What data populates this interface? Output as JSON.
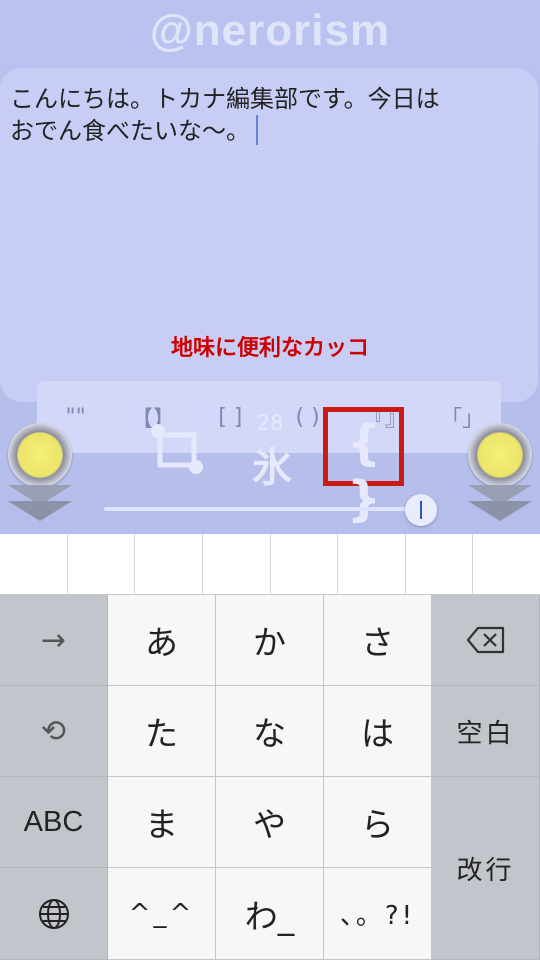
{
  "watermark": "@nerorism",
  "editor": {
    "line1": "こんにちは。トカナ編集部です。今日は",
    "line2": "おでん食べたいな〜。"
  },
  "caption": "地味に便利なカッコ",
  "bracket_palette": [
    "\"\"",
    "【】",
    "[ ]",
    "( )",
    "『』",
    "「」"
  ],
  "toolbar": {
    "font_size_count": "28",
    "font_size_glyph": "氷",
    "braces_label": "{ }",
    "slider_value": 1.0,
    "highlight_color": "#c91a14"
  },
  "icons": {
    "left_knob": "yellow-knob-icon",
    "right_knob": "yellow-knob-icon",
    "crop": "crop-icon",
    "backspace": "backspace-icon",
    "undo": "undo-icon",
    "globe": "globe-icon",
    "next": "arrow-right-icon"
  },
  "keyboard": {
    "next_key": "→",
    "undo_key": "⟲",
    "abc_key": "ABC",
    "globe_key": "🌐",
    "rows": [
      [
        "あ",
        "か",
        "さ"
      ],
      [
        "た",
        "な",
        "は"
      ],
      [
        "ま",
        "や",
        "ら"
      ],
      [
        "^_^",
        "わ_",
        "、。?!"
      ]
    ],
    "backspace_key": "⌫",
    "space_key": "空白",
    "return_key": "改行"
  }
}
